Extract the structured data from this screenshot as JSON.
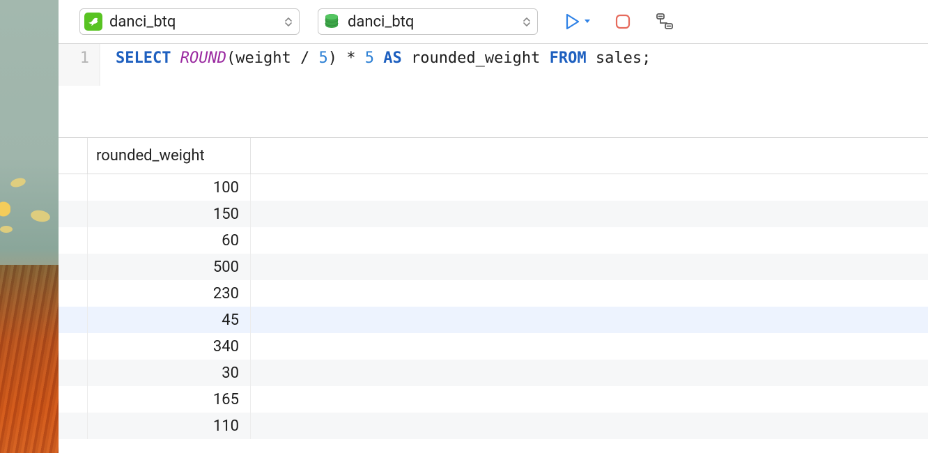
{
  "toolbar": {
    "connection_selector": {
      "label": "danci_btq"
    },
    "database_selector": {
      "label": "danci_btq"
    }
  },
  "editor": {
    "line_number": "1",
    "sql": {
      "kw_select": "SELECT",
      "fn_round": "ROUND",
      "sp0": " ",
      "lp": "(",
      "ident_weight": "weight",
      "sp1": " ",
      "op_div": "/",
      "sp2": " ",
      "num_5a": "5",
      "rp": ")",
      "sp3": " ",
      "op_mul": "*",
      "sp4": " ",
      "num_5b": "5",
      "sp5": " ",
      "kw_as": "AS",
      "sp6": " ",
      "ident_alias": "rounded_weight",
      "sp7": " ",
      "kw_from": "FROM",
      "sp8": " ",
      "ident_table": "sales",
      "semi": ";"
    }
  },
  "results": {
    "column_name": "rounded_weight",
    "rows": [
      {
        "value": "100",
        "selected": false
      },
      {
        "value": "150",
        "selected": false
      },
      {
        "value": "60",
        "selected": false
      },
      {
        "value": "500",
        "selected": false
      },
      {
        "value": "230",
        "selected": false
      },
      {
        "value": "45",
        "selected": true
      },
      {
        "value": "340",
        "selected": false
      },
      {
        "value": "30",
        "selected": false
      },
      {
        "value": "165",
        "selected": false
      },
      {
        "value": "110",
        "selected": false
      }
    ]
  }
}
